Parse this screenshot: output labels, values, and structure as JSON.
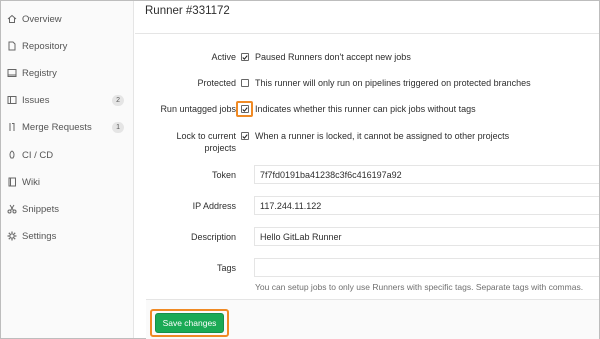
{
  "sidebar": {
    "items": [
      {
        "label": "Overview",
        "icon": "home-icon"
      },
      {
        "label": "Repository",
        "icon": "doc-icon"
      },
      {
        "label": "Registry",
        "icon": "box-icon"
      },
      {
        "label": "Issues",
        "icon": "issues-icon",
        "count": "2"
      },
      {
        "label": "Merge Requests",
        "icon": "merge-request-icon",
        "count": "1"
      },
      {
        "label": "CI / CD",
        "icon": "rocket-icon"
      },
      {
        "label": "Wiki",
        "icon": "book-icon"
      },
      {
        "label": "Snippets",
        "icon": "scissors-icon"
      },
      {
        "label": "Settings",
        "icon": "gear-icon"
      }
    ]
  },
  "page": {
    "title": "Runner #331172"
  },
  "form": {
    "active": {
      "label": "Active",
      "checked": true,
      "hint": "Paused Runners don't accept new jobs"
    },
    "protected": {
      "label": "Protected",
      "checked": false,
      "hint": "This runner will only run on pipelines triggered on protected branches"
    },
    "run_untagged": {
      "label": "Run untagged jobs",
      "checked": true,
      "hint": "Indicates whether this runner can pick jobs without tags"
    },
    "locked": {
      "label_line1": "Lock to current",
      "label_line2": "projects",
      "checked": true,
      "hint": "When a runner is locked, it cannot be assigned to other projects"
    },
    "token": {
      "label": "Token",
      "value": "7f7fd0191ba41238c3f6c416197a92"
    },
    "ip_address": {
      "label": "IP Address",
      "value": "117.244.11.122"
    },
    "description": {
      "label": "Description",
      "value": "Hello GitLab Runner"
    },
    "tags": {
      "label": "Tags",
      "value": "",
      "help": "You can setup jobs to only use Runners with specific tags. Separate tags with commas."
    }
  },
  "actions": {
    "save_label": "Save changes"
  },
  "colors": {
    "accent": "#1aaa55",
    "highlight": "#f08a24"
  }
}
